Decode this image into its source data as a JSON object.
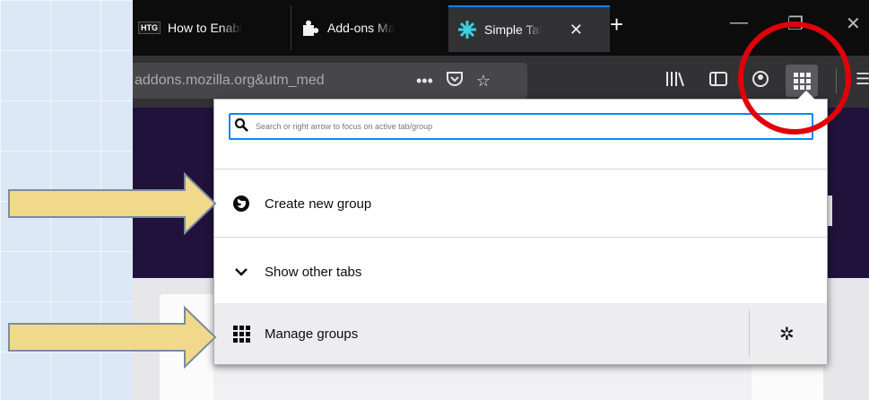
{
  "tabs": [
    {
      "favicon": "HTG",
      "title": "How to Enabl"
    },
    {
      "favicon": "puzzle-icon",
      "title": "Add-ons Ma"
    },
    {
      "favicon": "simple-tab-groups-icon",
      "title": "Simple Tal"
    }
  ],
  "toolbar": {
    "url": "addons.mozilla.org&utm_med"
  },
  "popup": {
    "search_placeholder": "Search or right arrow to focus on active tab/group",
    "create_group": "Create new group",
    "show_other_tabs": "Show other tabs",
    "manage_groups": "Manage groups"
  },
  "colors": {
    "highlight_circle": "#e1000a",
    "arrow_fill": "#f0d98a",
    "accent": "#0a84ff"
  }
}
